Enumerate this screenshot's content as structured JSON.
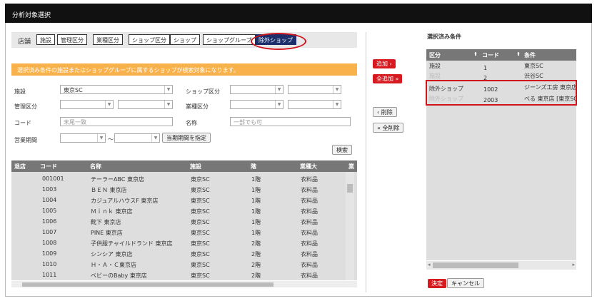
{
  "window": {
    "title": "分析対象選択"
  },
  "tabs": {
    "label": "店舗",
    "items": [
      {
        "label": "施設",
        "active": false
      },
      {
        "label": "管理区分",
        "active": false
      },
      {
        "label": "業種区分",
        "active": false
      },
      {
        "label": "ショップ区分",
        "active": false
      },
      {
        "label": "ショップ",
        "active": false
      },
      {
        "label": "ショップグループ",
        "active": false
      },
      {
        "label": "除外ショップ",
        "active": true
      }
    ]
  },
  "notice": "選択済み条件の施設またはショップグループに属するショップが検索対象になります。",
  "filters": {
    "facility_label": "施設",
    "facility_value": "東京SC",
    "shop_kubun_label": "ショップ区分",
    "kanri_label": "管理区分",
    "gyoshu_label": "業種区分",
    "code_label": "コード",
    "code_placeholder": "末尾一致",
    "name_label": "名称",
    "name_placeholder": "一部でも可",
    "period_label": "営業期間",
    "period_sep": "～",
    "period_button": "当期期間を指定",
    "search_button": "検索"
  },
  "actions": {
    "add": "追加 ›",
    "add_all": "全追加 »",
    "remove": "‹ 削除",
    "remove_all": "« 全削除"
  },
  "grid": {
    "headers": [
      "退店",
      "コード",
      "名称",
      "施設",
      "階",
      "業種大",
      "業"
    ],
    "rows": [
      {
        "code": "001001",
        "name": "テーラーABC 東京店",
        "facility": "東京SC",
        "floor": "1階",
        "gyoshu": "衣料品"
      },
      {
        "code": "1003",
        "name": "ＢＥＮ 東京店",
        "facility": "東京SC",
        "floor": "1階",
        "gyoshu": "衣料品"
      },
      {
        "code": "1004",
        "name": "カジュアルハウスF 東京店",
        "facility": "東京SC",
        "floor": "1階",
        "gyoshu": "衣料品"
      },
      {
        "code": "1005",
        "name": "Ｍｉｎｋ 東京店",
        "facility": "東京SC",
        "floor": "1階",
        "gyoshu": "衣料品"
      },
      {
        "code": "1006",
        "name": "靴下 東京店",
        "facility": "東京SC",
        "floor": "1階",
        "gyoshu": "衣料品"
      },
      {
        "code": "1007",
        "name": "PINE 東京店",
        "facility": "東京SC",
        "floor": "1階",
        "gyoshu": "衣料品"
      },
      {
        "code": "1008",
        "name": "子供服チャイルドランド 東京店",
        "facility": "東京SC",
        "floor": "2階",
        "gyoshu": "衣料品"
      },
      {
        "code": "1009",
        "name": "シンシア 東京店",
        "facility": "東京SC",
        "floor": "2階",
        "gyoshu": "衣料品"
      },
      {
        "code": "1010",
        "name": "Ｈ・Ａ・Ｃ東京店",
        "facility": "東京SC",
        "floor": "2階",
        "gyoshu": "衣料品"
      },
      {
        "code": "1011",
        "name": "ベビーのBaby 東京店",
        "facility": "東京SC",
        "floor": "2階",
        "gyoshu": "衣料品"
      }
    ]
  },
  "selected": {
    "title": "選択済み条件",
    "headers": [
      "区分",
      "コード",
      "条件"
    ],
    "rows": [
      {
        "kubun": "施設",
        "code": "1",
        "cond": "東京SC",
        "faded_kubun": false
      },
      {
        "kubun": "施設",
        "code": "2",
        "cond": "渋谷SC",
        "faded_kubun": true
      },
      {
        "kubun": "除外ショップ",
        "code": "1002",
        "cond": "ジーンズ工房 東京店",
        "faded_kubun": false
      },
      {
        "kubun": "除外ショップ",
        "code": "2003",
        "cond": "べる 東京店 [東京SC]",
        "faded_kubun": true
      }
    ]
  },
  "footer": {
    "ok": "決定",
    "cancel": "キャンセル"
  }
}
